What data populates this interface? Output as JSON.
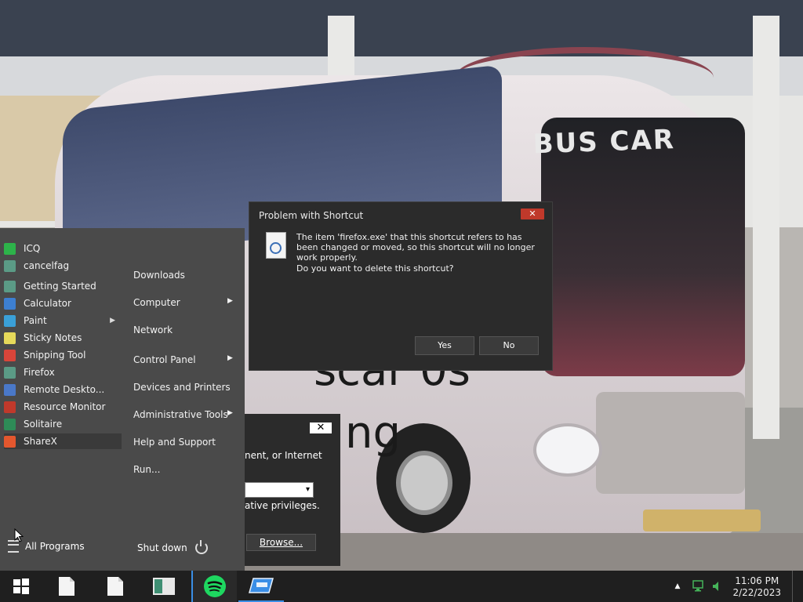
{
  "wallpaper": {
    "bus_sign": "BUS CAR",
    "overlay_text_1": "scar 0s",
    "overlay_text_2": "ng"
  },
  "start_menu": {
    "pinned": [
      {
        "label": "ICQ",
        "icon": "icq-icon",
        "color": "#2db34a"
      },
      {
        "label": "cancelfag",
        "icon": "app-window-icon",
        "color": "#5b9b86"
      },
      {
        "label": "Getting Started",
        "icon": "getting-started-icon",
        "color": "#5b9b86"
      },
      {
        "label": "Calculator",
        "icon": "calculator-icon",
        "color": "#3d7fd1"
      },
      {
        "label": "Paint",
        "icon": "paint-icon",
        "color": "#3aa0d8",
        "has_submenu": true
      },
      {
        "label": "Sticky Notes",
        "icon": "sticky-notes-icon",
        "color": "#e6d95a"
      },
      {
        "label": "Snipping Tool",
        "icon": "snipping-tool-icon",
        "color": "#d9453a"
      },
      {
        "label": "Firefox",
        "icon": "firefox-app-icon",
        "color": "#5b9b86"
      },
      {
        "label": "Remote Deskto...",
        "icon": "remote-desktop-icon",
        "color": "#4a78c8"
      },
      {
        "label": "Resource Monitor",
        "icon": "resource-monitor-icon",
        "color": "#c0392b"
      },
      {
        "label": "Solitaire",
        "icon": "solitaire-icon",
        "color": "#2e8b57"
      },
      {
        "label": "ShareX",
        "icon": "sharex-icon",
        "color": "#e4572e",
        "active": true
      }
    ],
    "all_programs": "All Programs",
    "places": [
      {
        "label": "Downloads",
        "submenu": false
      },
      {
        "label": "Computer",
        "submenu": true
      },
      {
        "label": "Network",
        "submenu": false
      },
      {
        "label": "Control Panel",
        "submenu": true
      },
      {
        "label": "Devices and Printers",
        "submenu": false
      },
      {
        "label": "Administrative Tools",
        "submenu": true
      },
      {
        "label": "Help and Support",
        "submenu": false
      },
      {
        "label": "Run...",
        "submenu": false
      }
    ],
    "shutdown": "Shut down"
  },
  "run_dialog": {
    "close": "✕",
    "description_fragment": "nent, or Internet",
    "privileges_fragment": "ative privileges.",
    "browse": "Browse..."
  },
  "shortcut_dialog": {
    "title": "Problem with Shortcut",
    "close": "✕",
    "message": "The item 'firefox.exe' that this shortcut refers to has been changed or moved, so this shortcut will no longer work properly.",
    "question": "Do you want to delete this shortcut?",
    "yes": "Yes",
    "no": "No"
  },
  "taskbar": {
    "time": "11:06 PM",
    "date": "2/22/2023",
    "accent": "#3a8ee6"
  }
}
